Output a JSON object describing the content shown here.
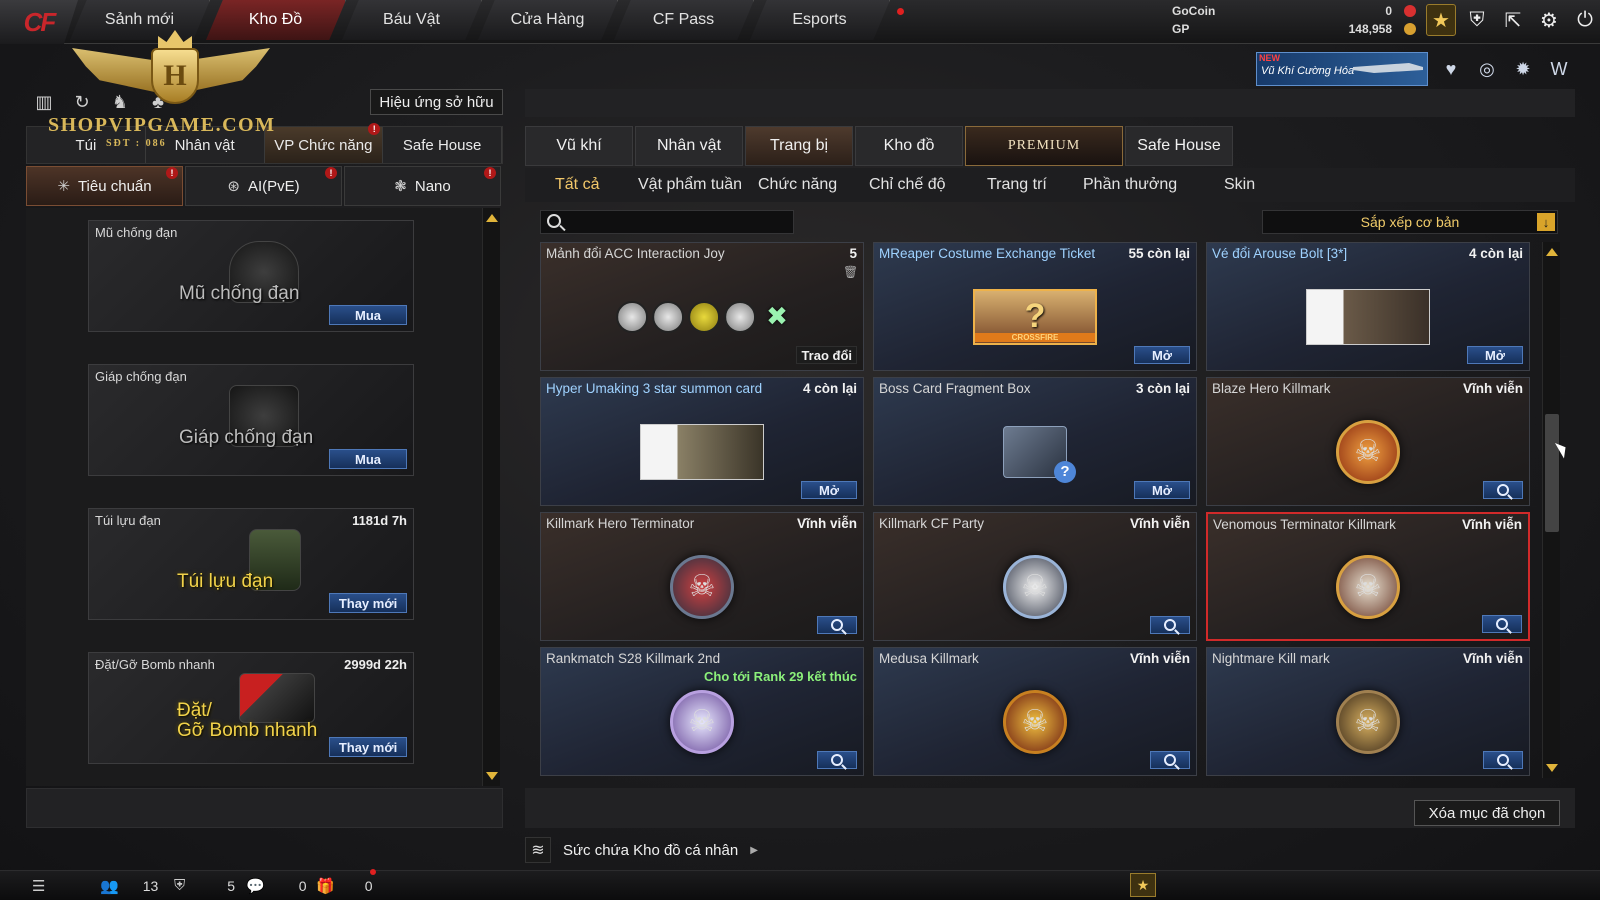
{
  "topnav": {
    "logo": "CF",
    "tabs": [
      "Sảnh mới",
      "Kho Đồ",
      "Báu Vật",
      "Cửa Hàng",
      "CF Pass",
      "Esports"
    ],
    "active_index": 1
  },
  "currency": {
    "gocoin_label": "GoCoin",
    "gocoin_value": "0",
    "gp_label": "GP",
    "gp_value": "148,958"
  },
  "top_icons": [
    "rank-icon",
    "shield-icon",
    "exit-icon",
    "gear-icon",
    "power-icon"
  ],
  "promo": {
    "new_label": "NEW",
    "text": "Vũ Khí Cường Hóa"
  },
  "promo_icons": [
    "v-emblem-icon",
    "globe-emblem-icon",
    "burst-emblem-icon",
    "w-emblem-icon"
  ],
  "watermark": {
    "letter": "H",
    "text": "SHOPVIPGAME.COM",
    "sub": "SĐT : 086"
  },
  "left": {
    "effect_button": "Hiệu ứng sở hữu",
    "tabs": [
      "Túi",
      "Nhân vật",
      "VP Chức năng",
      "Safe House"
    ],
    "active_tab": 2,
    "subtabs": [
      "Tiêu chuẩn",
      "AI(PvE)",
      "Nano"
    ],
    "items": [
      {
        "name": "Mũ chống đạn",
        "time": "",
        "big": "Mũ chống đạn",
        "button": "Mua"
      },
      {
        "name": "Giáp chống đạn",
        "time": "",
        "big": "Giáp chống đạn",
        "button": "Mua"
      },
      {
        "name": "Túi lựu đạn",
        "time": "1181d 7h",
        "big": "Túi lựu đạn",
        "button": "Thay mới"
      },
      {
        "name": "Đặt/Gỡ Bomb nhanh",
        "time": "2999d 22h",
        "big": "Đặt/\nGỡ Bomb nhanh",
        "button": "Thay mới"
      }
    ]
  },
  "right": {
    "tabs": [
      "Vũ khí",
      "Nhân vật",
      "Trang bị",
      "Kho đồ",
      "PREMIUM",
      "Safe House"
    ],
    "active_tab": 2,
    "categories": [
      "Tất cả",
      "Vật phẩm tuần",
      "Chức năng",
      "Chỉ chế độ",
      "Trang trí",
      "Phần thưởng",
      "Skin"
    ],
    "active_category": 0,
    "search": {
      "placeholder": ""
    },
    "sort": "Sắp xếp cơ bản",
    "items": [
      {
        "name": "Mảnh đổi ACC Interaction Joy",
        "right": "5",
        "action": "Trao đổi"
      },
      {
        "name": "MReaper Costume Exchange Ticket",
        "right": "55 còn lại",
        "action": "Mở"
      },
      {
        "name": "Vé đổi Arouse Bolt [3*]",
        "right": "4 còn lại",
        "action": "Mở"
      },
      {
        "name": "Hyper Umaking 3 star summon card",
        "right": "4 còn lại",
        "action": "Mở"
      },
      {
        "name": "Boss Card Fragment Box",
        "right": "3 còn lại",
        "action": "Mở"
      },
      {
        "name": "Blaze Hero Killmark",
        "right": "Vĩnh viễn",
        "action": ""
      },
      {
        "name": "Killmark Hero Terminator",
        "right": "Vĩnh viễn",
        "action": ""
      },
      {
        "name": "Killmark CF Party",
        "right": "Vĩnh viễn",
        "action": ""
      },
      {
        "name": "Venomous Terminator Killmark",
        "right": "Vĩnh viễn",
        "action": ""
      },
      {
        "name": "Rankmatch S28 Killmark 2nd",
        "right": "",
        "note": "Cho tới Rank 29 kết thúc",
        "action": ""
      },
      {
        "name": "Medusa Killmark",
        "right": "Vĩnh viễn",
        "action": ""
      },
      {
        "name": "Nightmare Kill mark",
        "right": "Vĩnh viễn",
        "action": ""
      }
    ],
    "selected_index": 8,
    "clear_button": "Xóa mục đã chọn",
    "capacity_label": "Sức chứa Kho đồ cá nhân"
  },
  "bottom": {
    "friends_count": "13",
    "clan_count": "5",
    "chat_count": "0",
    "gift_count": "0"
  }
}
